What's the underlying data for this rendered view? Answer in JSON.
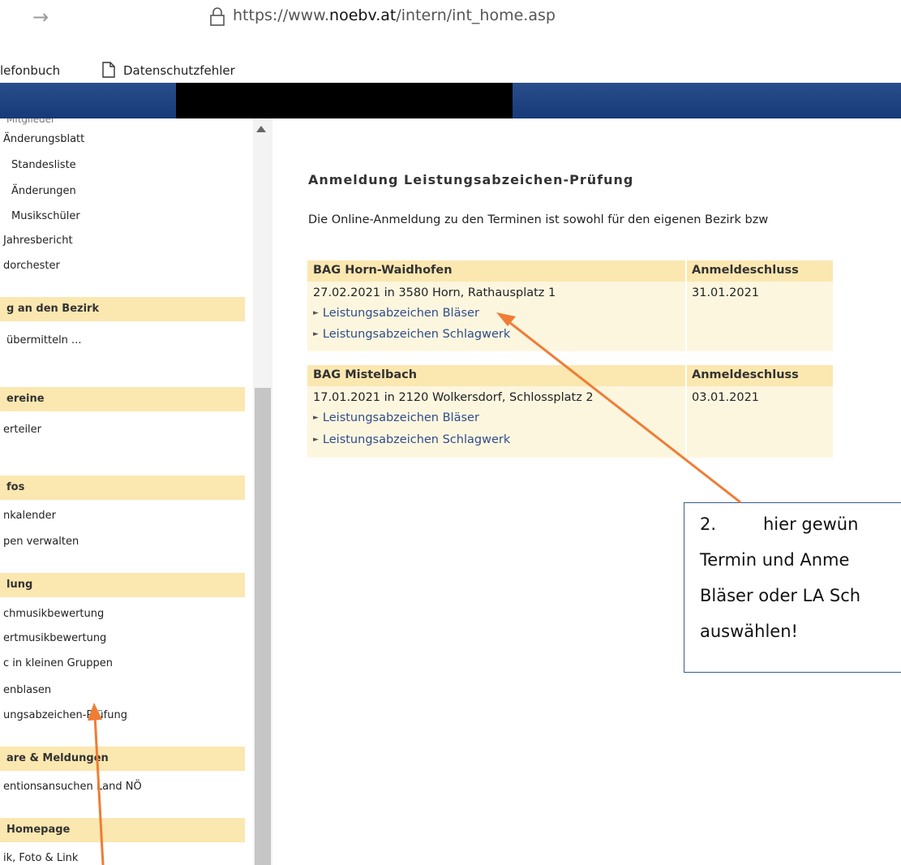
{
  "browser": {
    "back_icon": "arrow-right-icon",
    "url_scheme": "https://www.",
    "url_domain": "noebv.at",
    "url_path": "/intern/int_home.asp"
  },
  "bookmarks": {
    "item1": "lefonbuch",
    "item2": "Datenschutzfehler"
  },
  "sidebar": {
    "cut_top": "Mitglieder",
    "items_top": [
      "Änderungsblatt",
      "Standesliste",
      "Änderungen",
      "Musikschüler",
      "Jahresbericht",
      "dorchester"
    ],
    "section_bezirk": "g an den Bezirk",
    "item_uebermitteln": "übermitteln ...",
    "section_vereine": "ereine",
    "item_verteiler": "erteiler",
    "section_infos": "fos",
    "items_infos": [
      "nkalender",
      "pen verwalten"
    ],
    "section_lung": "lung",
    "items_lung": [
      "chmusikbewertung",
      "ertmusikbewertung",
      "c in kleinen Gruppen",
      "enblasen",
      "ungsabzeichen-Prüfung"
    ],
    "section_meldungen": "are & Meldungen",
    "item_ventions": "entionsansuchen Land NÖ",
    "section_homepage": "Homepage",
    "item_foto": "ik, Foto & Link"
  },
  "main": {
    "title": "Anmeldung Leistungsabzeichen-Prüfung",
    "intro": "Die Online-Anmeldung zu den Terminen ist sowohl für den eigenen Bezirk bzw"
  },
  "bags": [
    {
      "name": "BAG Horn-Waidhofen",
      "deadline_label": "Anmeldeschluss",
      "date_line": "27.02.2021 in 3580 Horn, Rathausplatz 1",
      "deadline": "31.01.2021",
      "link1": "Leistungsabzeichen Bläser",
      "link2": "Leistungsabzeichen Schlagwerk"
    },
    {
      "name": "BAG Mistelbach",
      "deadline_label": "Anmeldeschluss",
      "date_line": "17.01.2021 in 2120 Wolkersdorf, Schlossplatz 2",
      "deadline": "03.01.2021",
      "link1": "Leistungsabzeichen Bläser",
      "link2": "Leistungsabzeichen Schlagwerk"
    }
  ],
  "callout": {
    "line1_num": "2.",
    "line1_text": "hier gewün",
    "line2": "Termin und Anme",
    "line3": "Bläser oder LA Sch",
    "line4": "auswählen!"
  },
  "colors": {
    "header_blue": "#1e4282",
    "section_bg": "#fbe7b0",
    "table_bg": "#fdf6df",
    "link": "#2e4d8c",
    "arrow": "#ef7d35"
  }
}
